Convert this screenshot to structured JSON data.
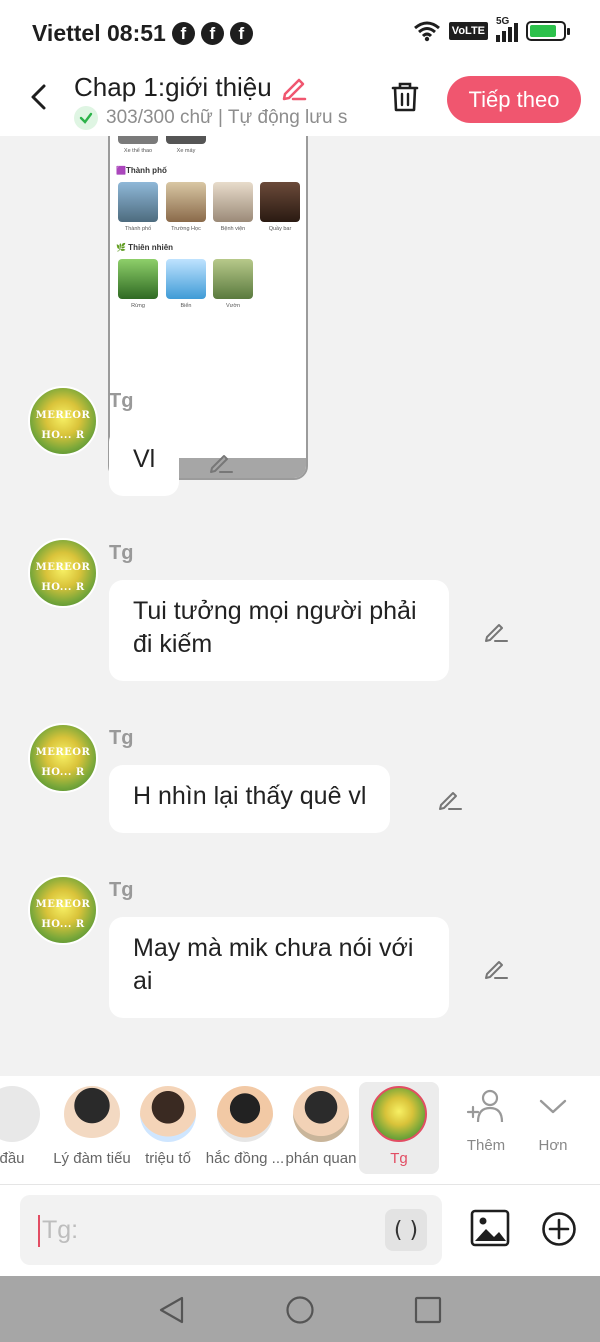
{
  "status_bar": {
    "carrier_time": "Viettel 08:51",
    "fb_icon": "f",
    "volte": "VoLTE",
    "network": "5G"
  },
  "header": {
    "title": "Chap 1:giới thiệu",
    "word_count": "303/300 chữ | Tự động lưu s",
    "next_button": "Tiếp theo"
  },
  "preview_shot": {
    "row1_caps": [
      "Xe thể thao",
      "Xe máy"
    ],
    "section_city": "🟪Thành phố",
    "city_caps": [
      "Thành phố",
      "Trường Học",
      "Bệnh viện",
      "Quầy bar"
    ],
    "section_nature": "🌿 Thiên nhiên",
    "nature_caps": [
      "Rừng",
      "Biển",
      "Vườn"
    ]
  },
  "messages": [
    {
      "speaker": "Tg",
      "text": "Vl"
    },
    {
      "speaker": "Tg",
      "text": "Tui tưởng mọi người phải đi kiếm"
    },
    {
      "speaker": "Tg",
      "text": "H nhìn lại thấy quê vl"
    },
    {
      "speaker": "Tg",
      "text": "May mà mik chưa nói với ai"
    }
  ],
  "avatar_text": [
    "MEREOR",
    "HO... R"
  ],
  "characters": [
    {
      "name": "đầu"
    },
    {
      "name": "Lý đàm tiếu"
    },
    {
      "name": "triệu tố"
    },
    {
      "name": "hắc đồng ..."
    },
    {
      "name": "phán quan"
    },
    {
      "name": "Tg"
    }
  ],
  "tools": {
    "add": "Thêm",
    "more": "Hơn"
  },
  "composer": {
    "placeholder": "Tg:",
    "paren": "( )"
  },
  "colors": {
    "accent": "#f0566f",
    "bg": "#f2f2f2",
    "bubble": "#ffffff"
  }
}
